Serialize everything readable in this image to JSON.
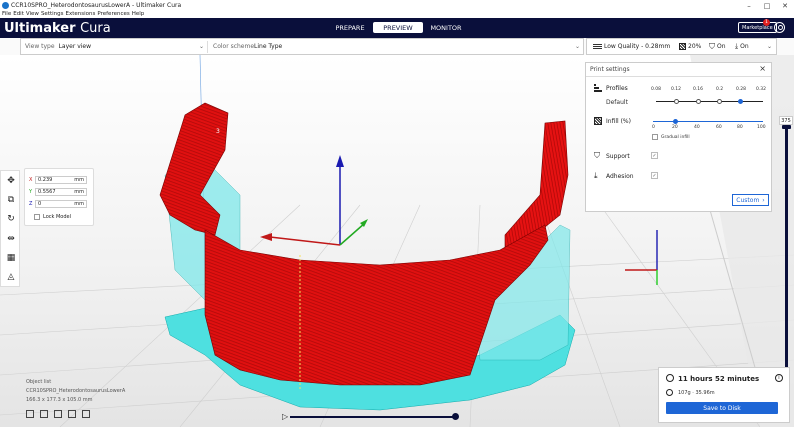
{
  "window": {
    "title": "CCR10SPRO_HeterodontosaurusLowerA - Ultimaker Cura",
    "controls": [
      "–",
      "□",
      "✕"
    ]
  },
  "menu": [
    "File",
    "Edit",
    "View",
    "Settings",
    "Extensions",
    "Preferences",
    "Help"
  ],
  "header": {
    "brand_bold": "Ultimaker",
    "brand_thin": "Cura",
    "stages": [
      "PREPARE",
      "PREVIEW",
      "MONITOR"
    ],
    "active_stage": "PREVIEW",
    "marketplace_label": "Marketplace",
    "marketplace_badge": "1"
  },
  "view_bar": {
    "view_type_label": "View type",
    "view_type_value": "Layer view",
    "color_scheme_label": "Color scheme",
    "color_scheme_value": "Line Type"
  },
  "print_setup_bar": {
    "quality": "Low Quality - 0.28mm",
    "infill": "20%",
    "support": "On",
    "adhesion": "On"
  },
  "move_panel": {
    "x_value": "0.239",
    "y_value": "0.5567",
    "z_value": "0",
    "unit": "mm",
    "lock_model_label": "Lock Model"
  },
  "print_settings": {
    "title": "Print settings",
    "profiles_label": "Profiles",
    "profile_name": "Default",
    "layer_heights": [
      "0.08",
      "0.12",
      "0.16",
      "0.2",
      "0.28",
      "0.32"
    ],
    "selected_layer_height": "0.28",
    "infill_label": "Infill (%)",
    "infill_ticks": [
      "0",
      "20",
      "40",
      "60",
      "80",
      "100"
    ],
    "infill_value": 20,
    "gradual_infill_label": "Gradual infill",
    "support_label": "Support",
    "adhesion_label": "Adhesion",
    "custom_button": "Custom"
  },
  "layer_slider": {
    "current_layer": "375"
  },
  "object_list": {
    "header": "Object list",
    "file_name": "CCR10SPRO_HeterodontosaurusLowerA",
    "dimensions": "166.3 x 177.3 x 105.0 mm"
  },
  "estimate": {
    "time": "11 hours 52 minutes",
    "material": "107g · 35.96m",
    "save_button": "Save to Disk"
  },
  "colors": {
    "header_bg": "#0a0f3b",
    "accent": "#1e66d6",
    "model_red": "#e01010",
    "support_cyan": "#5fe6e6"
  }
}
